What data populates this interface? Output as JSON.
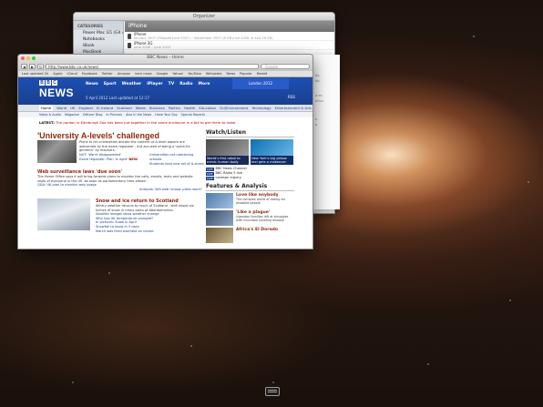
{
  "back_window": {
    "title": "Organizer",
    "sidebar_header": "CATEGORIES",
    "sidebar_items": [
      "Power Mac G5 (G4 AV)",
      "Notebooks",
      "iBook",
      "MacBook",
      "MacBook Air"
    ],
    "main_title": "iPhone",
    "rows": [
      {
        "name": "iPhone",
        "desc": "January 2007 (Shipped June 2007) – September 2007 (8 GB June 2008 (4 and 16 GB)"
      },
      {
        "name": "iPhone 3G",
        "desc": "June 2008 – June 2010"
      }
    ]
  },
  "peek_window": {
    "lines": [
      "do.",
      "do.",
      "d es",
      "ation.",
      "o.",
      "o."
    ]
  },
  "browser": {
    "window_title": "BBC News - Home",
    "url": "http://www.bbc.co.uk/news/",
    "search_placeholder": "Google",
    "back_label": "◀",
    "forward_label": "▶",
    "reload_label": "↻",
    "bookmarks": [
      "Last updated 2h",
      "Apple",
      "iCloud",
      "Facebook",
      "Twitter",
      "Amazon",
      "tech news",
      "Google",
      "Yahoo!",
      "YouTube",
      "Wikipedia",
      "News",
      "Popular",
      "Reddit"
    ]
  },
  "bbc": {
    "blocks": [
      "B",
      "B",
      "C"
    ],
    "brand": "NEWS",
    "nav": [
      "News",
      "Sport",
      "Weather",
      "iPlayer",
      "TV",
      "Radio",
      "More"
    ],
    "date_line": "5 April 2012  Last updated at 12:17",
    "olympic": "London 2012",
    "rss": "RSS",
    "tabs": [
      "Home",
      "World",
      "UK",
      "England",
      "N. Ireland",
      "Scotland",
      "Wales",
      "Business",
      "Politics",
      "Health",
      "Education",
      "Sci/Environment",
      "Technology",
      "Entertainment & Arts"
    ],
    "subtabs": [
      "Video & Audio",
      "Magazine",
      "Editors' Blog",
      "In Pictures",
      "Also in the News",
      "Have Your Say",
      "Special Reports"
    ],
    "ticker_label": "LATEST:",
    "ticker_text": "The pardon in Edinburgh Zoo has been put together in the same enclosure in a bid to get them to mate",
    "headline": "'University A-levels' challenged",
    "headline_text": "Plans to let universities dictate the content of A-level papers are welcomed by the exam regulator - but accused of being a 'quick-fix gimmick' by teachers.",
    "headline_links": [
      "NUT: 'We're disappointed'",
      "Exam regulator: Plan 'is right'"
    ],
    "headline_links_right": [
      "Universities not rubbishing schools",
      "Students lead new set of A-levels"
    ],
    "new_tag": "NEW",
    "story1_title": "Web surveillance laws 'due soon'",
    "story1_text": "The Home Office says it will bring forward plans to monitor the calls, emails, texts and website visits of everyone in the UK 'as soon as parliamentary time allows'.",
    "story1_link": "Q&A: UK plan to monitor web usage",
    "story1_right": "Analysis: Will web 'snoop' plans work?",
    "story2_title": "Snow and ice return to Scotland",
    "story2_text": "Wintry weather returns to much of Scotland - with about six inches of snow in many parts of Aberdeenshire.",
    "story2_links": [
      "Satellite images show weather change",
      "Why has UK temperature plunged?",
      "In pictures: Snow in April",
      "Snowfall to snow in 5 days",
      "March was third warmest on record"
    ],
    "watch_title": "Watch/Listen",
    "videos": [
      "World's first robot to mimic human body",
      "New York's big yellow taxi gets a makeover"
    ],
    "live": [
      {
        "tag": "LIVE",
        "label": "BBC News Channel"
      },
      {
        "tag": "LIVE",
        "label": "BBC Radio 5 live"
      },
      {
        "tag": "LIVE",
        "label": "Leveson Inquiry"
      }
    ],
    "features_title": "Features & Analysis",
    "features": [
      {
        "title": "Love like anybody",
        "desc": "The complex world of dating for disabled people"
      },
      {
        "title": "'Like a plague'",
        "desc": "Ugandan families left at struggles with incurable nodding disease"
      },
      {
        "title": "Africa's El Dorado",
        "desc": ""
      }
    ]
  }
}
